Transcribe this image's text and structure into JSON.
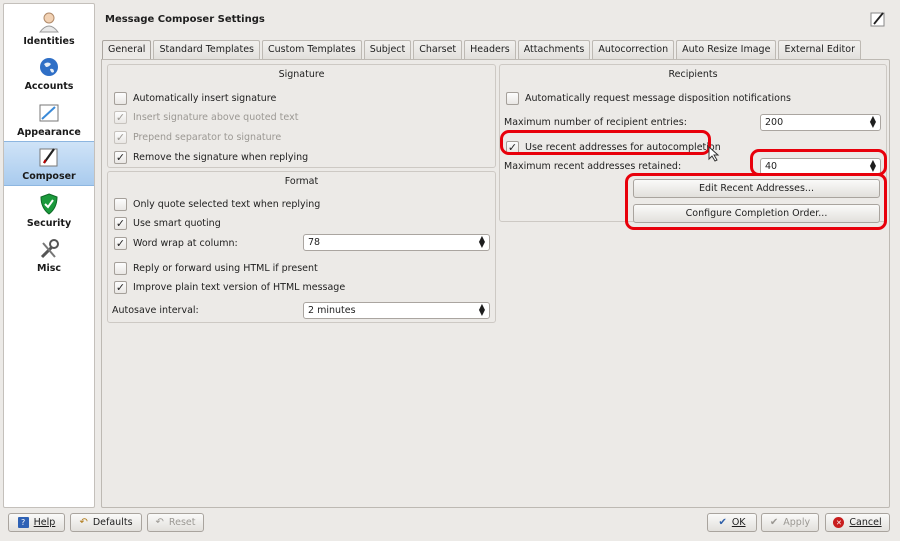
{
  "sidebar": {
    "items": [
      {
        "label": "Identities",
        "icon": "identity-icon"
      },
      {
        "label": "Accounts",
        "icon": "globe-icon"
      },
      {
        "label": "Appearance",
        "icon": "appearance-icon"
      },
      {
        "label": "Composer",
        "icon": "composer-pen-icon",
        "active": true
      },
      {
        "label": "Security",
        "icon": "shield-icon"
      },
      {
        "label": "Misc",
        "icon": "tools-icon"
      }
    ]
  },
  "header": {
    "title": "Message Composer Settings",
    "icon": "edit-icon"
  },
  "tabs": [
    {
      "label": "General",
      "active": true
    },
    {
      "label": "Standard Templates"
    },
    {
      "label": "Custom Templates"
    },
    {
      "label": "Subject"
    },
    {
      "label": "Charset"
    },
    {
      "label": "Headers"
    },
    {
      "label": "Attachments"
    },
    {
      "label": "Autocorrection"
    },
    {
      "label": "Auto Resize Image"
    },
    {
      "label": "External Editor"
    }
  ],
  "signature": {
    "title": "Signature",
    "auto_insert": {
      "label": "Automatically insert signature",
      "checked": false
    },
    "insert_above": {
      "label": "Insert signature above quoted text",
      "checked": true,
      "disabled": true
    },
    "prepend_separator": {
      "label": "Prepend separator to signature",
      "checked": true,
      "disabled": true
    },
    "remove_when_replying": {
      "label": "Remove the signature when replying",
      "checked": true
    }
  },
  "format": {
    "title": "Format",
    "only_quote_selected": {
      "label": "Only quote selected text when replying",
      "checked": false
    },
    "smart_quoting": {
      "label": "Use smart quoting",
      "checked": true
    },
    "word_wrap": {
      "label": "Word wrap at column:",
      "checked": true,
      "value": "78"
    },
    "reply_html": {
      "label": "Reply or forward using HTML if present",
      "checked": false
    },
    "improve_plain": {
      "label": "Improve plain text version of HTML message",
      "checked": true
    },
    "autosave_label": "Autosave interval:",
    "autosave_value": "2 minutes"
  },
  "recipients": {
    "title": "Recipients",
    "mdn": {
      "label": "Automatically request message disposition notifications",
      "checked": false
    },
    "max_entries_label": "Maximum number of recipient entries:",
    "max_entries_value": "200",
    "use_recent": {
      "label": "Use recent addresses for autocompletion",
      "checked": true
    },
    "max_recent_label": "Maximum recent addresses retained:",
    "max_recent_value": "40",
    "edit_recent_button": "Edit Recent Addresses...",
    "configure_order_button": "Configure Completion Order..."
  },
  "footer": {
    "help": "Help",
    "defaults": "Defaults",
    "reset": "Reset",
    "ok": "OK",
    "apply": "Apply",
    "cancel": "Cancel"
  },
  "colors": {
    "highlight_annotation": "#e8000b",
    "selection_blue": "#a9cbee"
  }
}
